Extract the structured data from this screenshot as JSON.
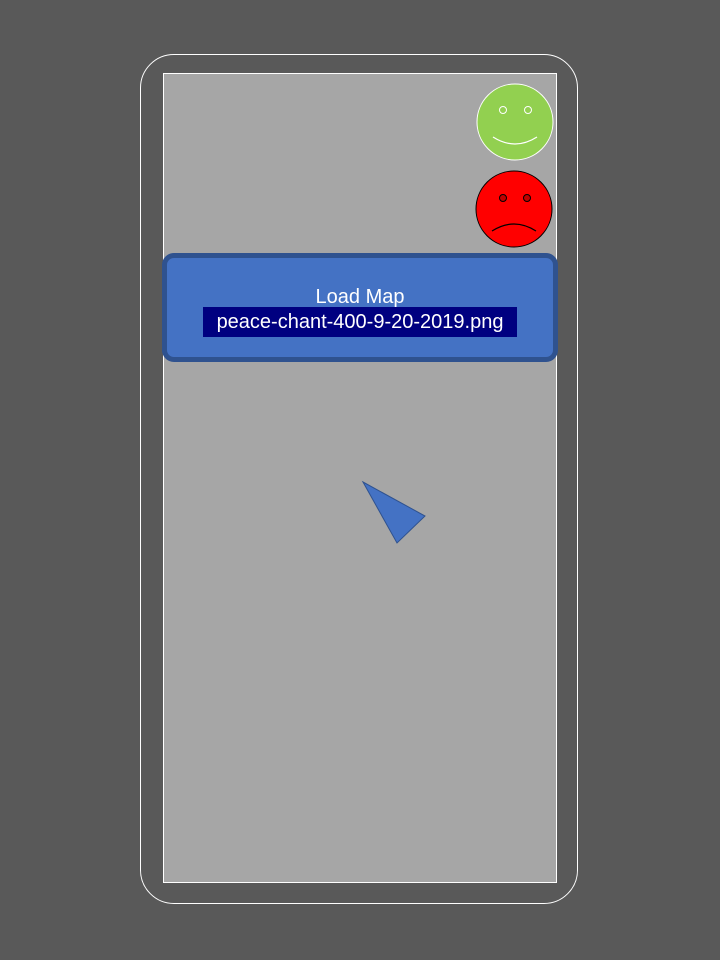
{
  "load_map": {
    "label": "Load Map",
    "file": "peace-chant-400-9-20-2019.png"
  },
  "icons": {
    "happy": "happy-face-icon",
    "sad": "sad-face-icon",
    "pointer": "triangle-pointer-icon"
  },
  "colors": {
    "background": "#595959",
    "screen": "#a6a6a6",
    "panel": "#4472c4",
    "panel_border": "#2f528f",
    "highlight": "#000080",
    "happy_face": "#92d050",
    "sad_face": "#ff0000"
  }
}
